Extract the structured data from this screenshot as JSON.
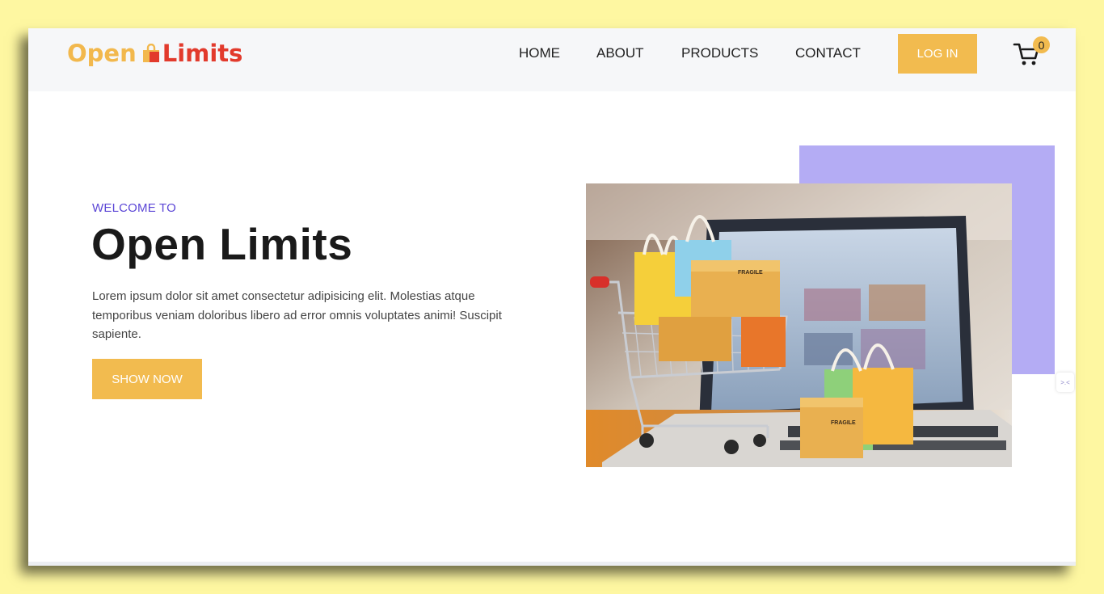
{
  "brand": {
    "open": "Open",
    "limits": "Limits"
  },
  "nav": {
    "home": "HOME",
    "about": "ABOUT",
    "products": "PRODUCTS",
    "contact": "CONTACT",
    "login": "LOG IN"
  },
  "cart": {
    "count": "0",
    "icon": "shopping-cart-icon"
  },
  "hero": {
    "eyebrow": "WELCOME TO",
    "title": "Open Limits",
    "description": "Lorem ipsum dolor sit amet consectetur adipisicing elit. Molestias atque temporibus veniam doloribus libero ad error omnis voluptates animi! Suscipit sapiente.",
    "cta": "SHOW NOW",
    "image": "shopping-cart-with-bags-and-laptop",
    "box_label": "FRAGILE"
  },
  "widget": {
    "label": ">.<"
  },
  "colors": {
    "background": "#fef7a1",
    "accent": "#f2bb4f",
    "brand_red": "#e23a2c",
    "purple": "#b4acf4",
    "eyebrow": "#5b46d6"
  }
}
